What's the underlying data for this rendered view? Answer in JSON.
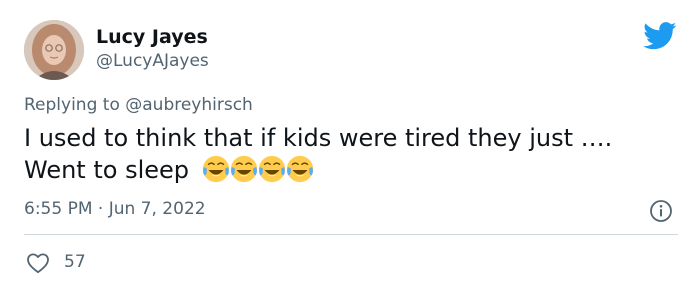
{
  "author": {
    "name": "Lucy Jayes",
    "handle": "@LucyAJayes",
    "avatar_icon": "profile-photo"
  },
  "reply": {
    "prefix": "Replying to ",
    "mention": "@aubreyhirsch"
  },
  "tweet": {
    "line1": "I used to think that if kids were tired they just ….",
    "line2": "Went to sleep",
    "emoji_name": "face-with-tears-of-joy",
    "emoji_count": 4
  },
  "meta": {
    "time": "6:55 PM",
    "separator": " · ",
    "date": "Jun 7, 2022"
  },
  "stats": {
    "likes": "57"
  },
  "colors": {
    "twitter_blue": "#1d9bf0",
    "secondary_text": "#536471",
    "primary_text": "#0f1419",
    "divider": "#cfd9de"
  },
  "icons": {
    "brand": "twitter-bird-icon",
    "info": "info-icon",
    "like": "heart-icon"
  }
}
